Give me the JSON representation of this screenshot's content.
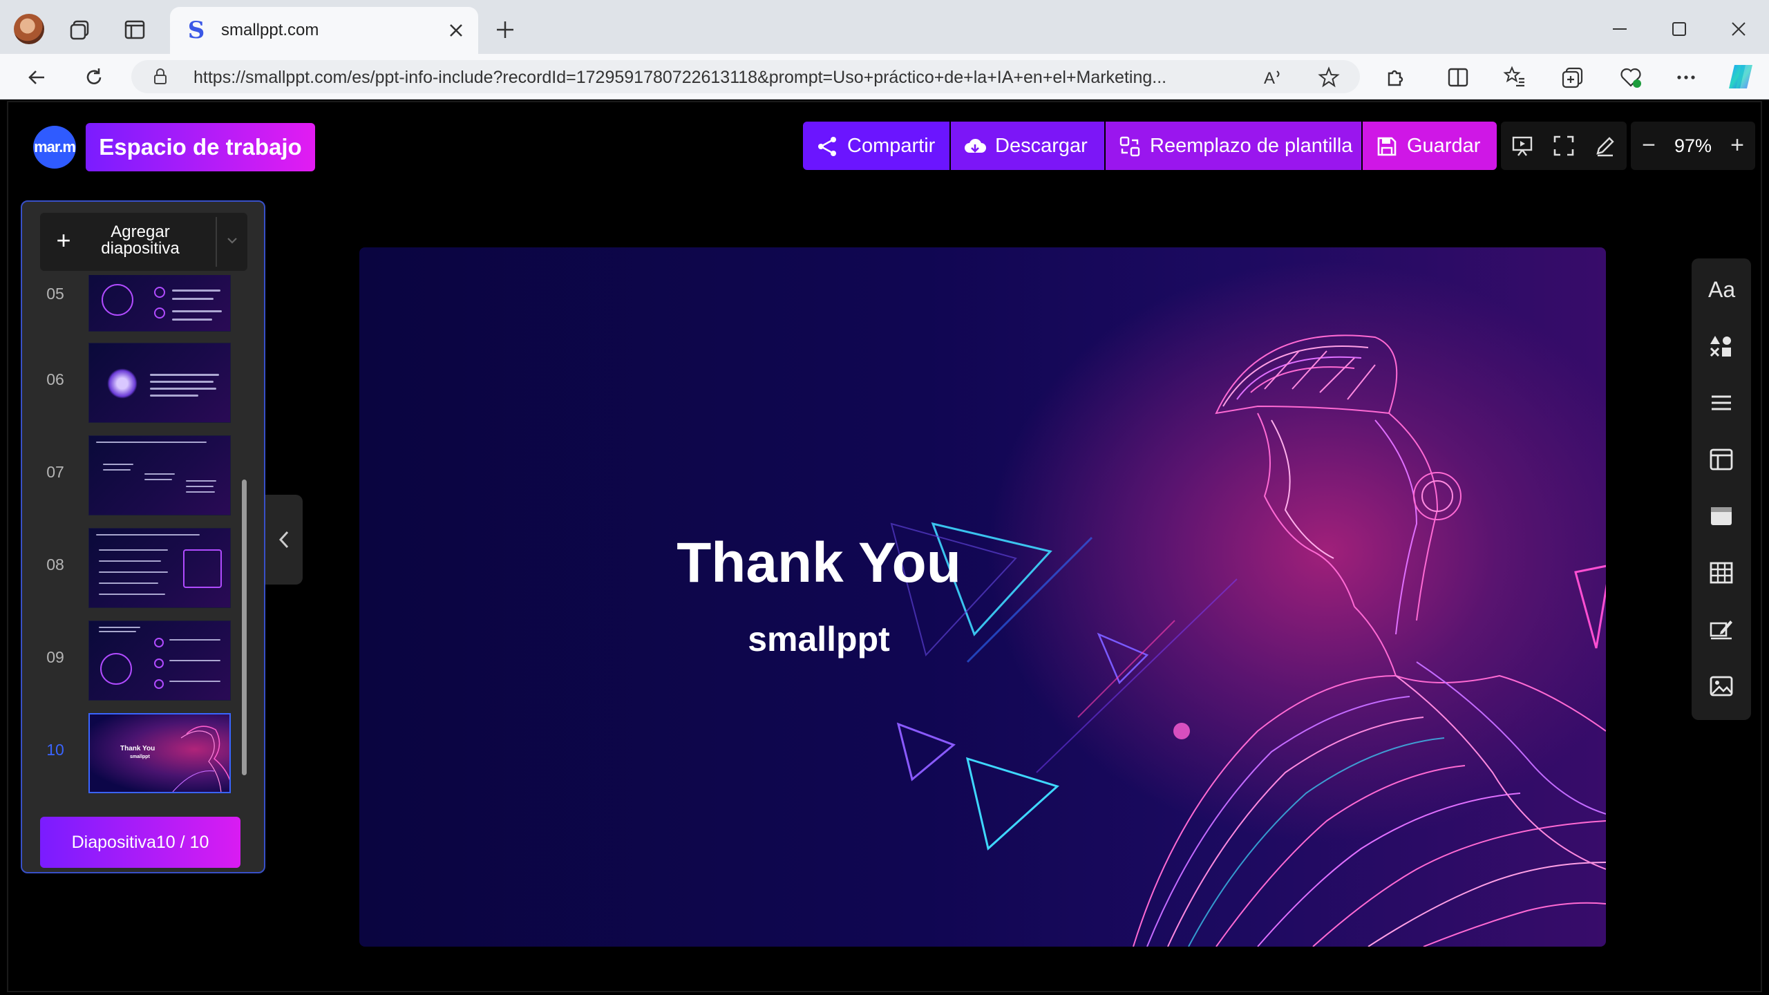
{
  "browser": {
    "tab_title": "smallppt.com",
    "url": "https://smallppt.com/es/ppt-info-include?recordId=1729591780722613118&prompt=Uso+práctico+de+la+IA+en+el+Marketing..."
  },
  "header": {
    "avatar_text": "mar.m",
    "workspace_label": "Espacio de trabajo",
    "share_label": "Compartir",
    "download_label": "Descargar",
    "template_label": "Reemplazo de plantilla",
    "save_label": "Guardar",
    "zoom": "97%",
    "zoom_minus": "−",
    "zoom_plus": "+"
  },
  "sidebar": {
    "add_slide_label": "Agregar diapositiva",
    "slides": [
      {
        "num": "05",
        "active": false
      },
      {
        "num": "06",
        "active": false
      },
      {
        "num": "07",
        "active": false
      },
      {
        "num": "08",
        "active": false
      },
      {
        "num": "09",
        "active": false
      },
      {
        "num": "10",
        "active": true
      }
    ],
    "active_thumb_title": "Thank You",
    "active_thumb_sub": "smallppt",
    "counter": "Diapositiva10 / 10"
  },
  "slide": {
    "title": "Thank You",
    "subtitle": "smallppt"
  },
  "colors": {
    "accent_start": "#7a1cff",
    "accent_end": "#e21cf2",
    "active_blue": "#3a64ff"
  }
}
